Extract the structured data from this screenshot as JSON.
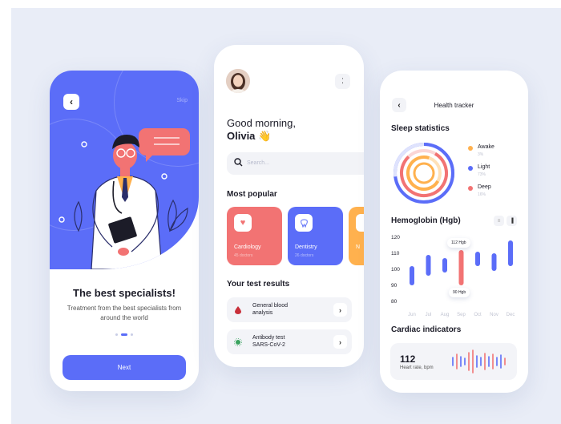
{
  "onboarding": {
    "skip_label": "Skip",
    "title": "The best specialists!",
    "subtitle": "Treatment from the best specialists from around the world",
    "next_label": "Next"
  },
  "home": {
    "greeting": "Good morning,",
    "user_name": "Olivia 👋",
    "search_placeholder": "Search...",
    "popular_title": "Most popular",
    "categories": [
      {
        "label": "Cardiology",
        "sub": "45 doctors",
        "color": "#f27373"
      },
      {
        "label": "Dentistry",
        "sub": "26 doctors",
        "color": "#5b6df8"
      },
      {
        "label": "N",
        "sub": "",
        "color": "#ffb14e"
      }
    ],
    "results_title": "Your test results",
    "tests": [
      {
        "line1": "General blood",
        "line2": "analysis"
      },
      {
        "line1": "Antibody test",
        "line2": "SARS-CoV-2"
      }
    ]
  },
  "tracker": {
    "header": "Health tracker",
    "sleep_title": "Sleep statistics",
    "sleep_legend": [
      {
        "label": "Awake",
        "pct": "3%",
        "color": "#ffb14e"
      },
      {
        "label": "Light",
        "pct": "73%",
        "color": "#5b6df8"
      },
      {
        "label": "Deep",
        "pct": "16%",
        "color": "#f27373"
      }
    ],
    "hgb_title": "Hemoglobin (Hgb)",
    "cardiac_title": "Cardiac indicators",
    "heart_rate_value": "112",
    "heart_rate_label": "Heart rate, bpm"
  },
  "colors": {
    "primary": "#5b6df8",
    "coral": "#f27373",
    "orange": "#ffb14e"
  },
  "chart_data": {
    "type": "bar",
    "title": "Hemoglobin (Hgb)",
    "categories": [
      "Jun",
      "Jul",
      "Aug",
      "Sep",
      "Oct",
      "Nov",
      "Dec"
    ],
    "ranges": [
      [
        90,
        102
      ],
      [
        96,
        109
      ],
      [
        98,
        107
      ],
      [
        90,
        112
      ],
      [
        102,
        111
      ],
      [
        99,
        110
      ],
      [
        102,
        118
      ]
    ],
    "highlight_index": 3,
    "annotations": [
      "112 Hgb",
      "90 Hgb"
    ],
    "yticks": [
      120,
      110,
      100,
      90,
      80
    ],
    "ylim": [
      80,
      120
    ],
    "grid": false
  }
}
